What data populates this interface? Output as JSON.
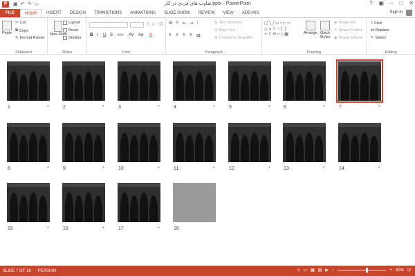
{
  "titlebar": {
    "app_icon": "P",
    "title": "تفاوت های فردی در کار.pptx - PowerPoint",
    "qat_icons": [
      "save-icon",
      "undo-icon",
      "redo-icon",
      "start-from-beginning-icon"
    ]
  },
  "tabs": [
    "FILE",
    "HOME",
    "INSERT",
    "DESIGN",
    "TRANSITIONS",
    "ANIMATIONS",
    "SLIDE SHOW",
    "REVIEW",
    "VIEW",
    "ADD-INS"
  ],
  "active_tab": "HOME",
  "signin_label": "Sign in",
  "ribbon": {
    "clipboard": {
      "label": "Clipboard",
      "paste": "Paste",
      "cut": "Cut",
      "copy": "Copy",
      "format_painter": "Format Painter"
    },
    "slides": {
      "label": "Slides",
      "new_slide": "New Slide",
      "layout": "Layout",
      "reset": "Reset",
      "section": "Section"
    },
    "font": {
      "label": "Font",
      "bold": "B",
      "italic": "I",
      "underline": "U",
      "strike": "S",
      "shadow": "abc",
      "spacing": "AV",
      "case": "Aa",
      "grow": "A",
      "shrink": "A",
      "color": "A"
    },
    "paragraph": {
      "label": "Paragraph",
      "text_direction": "Text Direction",
      "align_text": "Align Text",
      "convert_smartart": "Convert to SmartArt"
    },
    "drawing": {
      "label": "Drawing",
      "arrange": "Arrange",
      "quick_styles": "Quick Styles",
      "shape_fill": "Shape Fill",
      "shape_outline": "Shape Outline",
      "shape_effects": "Shape Effects"
    },
    "editing": {
      "label": "Editing",
      "find": "Find",
      "replace": "Replace",
      "select": "Select"
    }
  },
  "slides": [
    {
      "num": "1"
    },
    {
      "num": "2"
    },
    {
      "num": "3"
    },
    {
      "num": "4"
    },
    {
      "num": "5"
    },
    {
      "num": "6"
    },
    {
      "num": "7"
    },
    {
      "num": "8"
    },
    {
      "num": "9"
    },
    {
      "num": "10"
    },
    {
      "num": "11"
    },
    {
      "num": "12"
    },
    {
      "num": "13"
    },
    {
      "num": "14"
    },
    {
      "num": "15"
    },
    {
      "num": "16"
    },
    {
      "num": "17"
    },
    {
      "num": "18"
    }
  ],
  "selected_slide": 7,
  "transition_star": "*",
  "status": {
    "slide_info": "SLIDE 7 OF 18",
    "language": "PERSIAN",
    "zoom": "60%",
    "zoom_fraction": 0.6
  },
  "colors": {
    "accent": "#c8452b",
    "slide_bg": "#2f2f2f"
  }
}
